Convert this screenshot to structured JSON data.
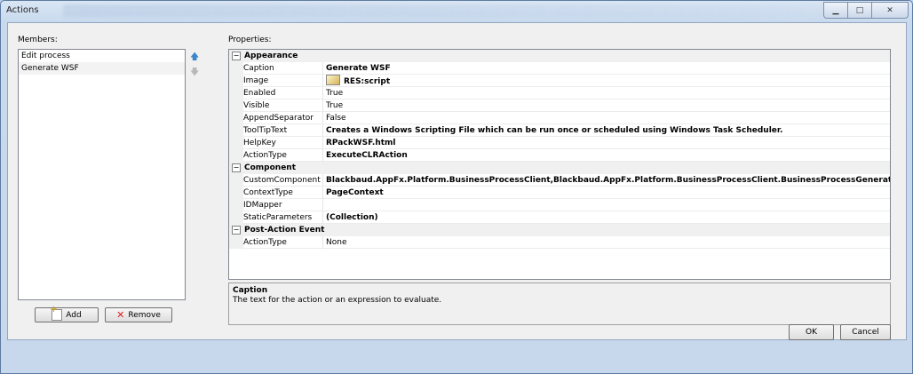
{
  "window": {
    "title": "Actions"
  },
  "members": {
    "label": "Members:",
    "items": [
      "Edit process",
      "Generate WSF"
    ],
    "add_label": "Add",
    "remove_label": "Remove"
  },
  "properties": {
    "label": "Properties:",
    "categories": [
      {
        "name": "Appearance",
        "rows": [
          {
            "name": "Caption",
            "value": "Generate WSF",
            "bold": true
          },
          {
            "name": "Image",
            "value": "RES:script",
            "bold": true,
            "icon": "image-icon"
          },
          {
            "name": "Enabled",
            "value": "True",
            "bold": false
          },
          {
            "name": "Visible",
            "value": "True",
            "bold": false
          },
          {
            "name": "AppendSeparator",
            "value": "False",
            "bold": false
          },
          {
            "name": "ToolTipText",
            "value": "Creates a Windows Scripting File which can be run once or scheduled using Windows Task Scheduler.",
            "bold": true
          },
          {
            "name": "HelpKey",
            "value": "RPackWSF.html",
            "bold": true
          },
          {
            "name": "ActionType",
            "value": "ExecuteCLRAction",
            "bold": true
          }
        ]
      },
      {
        "name": "Component",
        "rows": [
          {
            "name": "CustomComponent",
            "value": "Blackbaud.AppFx.Platform.BusinessProcessClient,Blackbaud.AppFx.Platform.BusinessProcessClient.BusinessProcessGenerateWsfAction",
            "bold": true
          },
          {
            "name": "ContextType",
            "value": "PageContext",
            "bold": true
          },
          {
            "name": "IDMapper",
            "value": "",
            "bold": false
          },
          {
            "name": "StaticParameters",
            "value": "(Collection)",
            "bold": true
          }
        ]
      },
      {
        "name": "Post-Action Event",
        "rows": [
          {
            "name": "ActionType",
            "value": "None",
            "bold": false
          }
        ]
      }
    ],
    "collapse_glyph": "⊟"
  },
  "description": {
    "title": "Caption",
    "text": "The text for the action or an expression to evaluate."
  },
  "footer": {
    "ok_label": "OK",
    "cancel_label": "Cancel"
  }
}
